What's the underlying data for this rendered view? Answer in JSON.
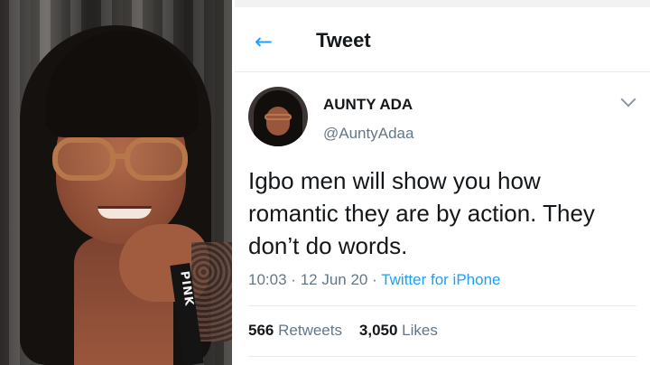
{
  "photo": {
    "strap_text": "PINK"
  },
  "header": {
    "back_icon": "arrow-left-icon",
    "title": "Tweet"
  },
  "tweet": {
    "author_name": "AUNTY ADA",
    "author_handle": "@AuntyAdaa",
    "text": "Igbo men will show you how romantic they are by action. They don’t do words.",
    "time": "10:03",
    "sep1": "·",
    "date": "12 Jun 20",
    "sep2": "·",
    "source": "Twitter for iPhone",
    "retweets_count": "566",
    "retweets_label": "Retweets",
    "likes_count": "3,050",
    "likes_label": "Likes"
  },
  "colors": {
    "accent": "#1da1f2",
    "text": "#14171a",
    "secondary": "#657786"
  }
}
